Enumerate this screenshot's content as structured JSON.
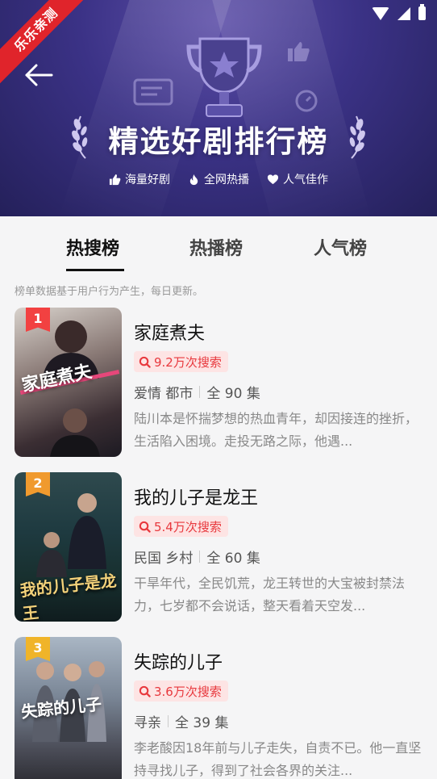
{
  "ribbon": "乐乐亲测",
  "header": {
    "title": "精选好剧排行榜",
    "tags": [
      "海量好剧",
      "全网热播",
      "人气佳作"
    ]
  },
  "tabs": [
    {
      "label": "热搜榜",
      "active": true
    },
    {
      "label": "热播榜",
      "active": false
    },
    {
      "label": "人气榜",
      "active": false
    }
  ],
  "note": "榜单数据基于用户行为产生，每日更新。",
  "items": [
    {
      "rank": "1",
      "rank_color": "#f24141",
      "poster_text": "家庭煮夫",
      "title": "家庭煮夫",
      "searches": "9.2万次搜索",
      "genre": "爱情 都市",
      "episodes": "全 90 集",
      "desc": "陆川本是怀揣梦想的热血青年，却因接连的挫折，生活陷入困境。走投无路之际，他遇..."
    },
    {
      "rank": "2",
      "rank_color": "#f09a2e",
      "poster_text": "我的儿子是龙王",
      "title": "我的儿子是龙王",
      "searches": "5.4万次搜索",
      "genre": "民国 乡村",
      "episodes": "全 60 集",
      "desc": "干旱年代，全民饥荒，龙王转世的大宝被封禁法力，七岁都不会说话，整天看着天空发..."
    },
    {
      "rank": "3",
      "rank_color": "#f0b429",
      "poster_text": "失踪的儿子",
      "title": "失踪的儿子",
      "searches": "3.6万次搜索",
      "genre": "寻亲",
      "episodes": "全 39 集",
      "desc": "李老酸因18年前与儿子走失，自责不已。他一直坚持寻找儿子，得到了社会各界的关注..."
    }
  ],
  "colors": {
    "accent_red": "#e8383d",
    "hero_bg": "#3b3286"
  }
}
